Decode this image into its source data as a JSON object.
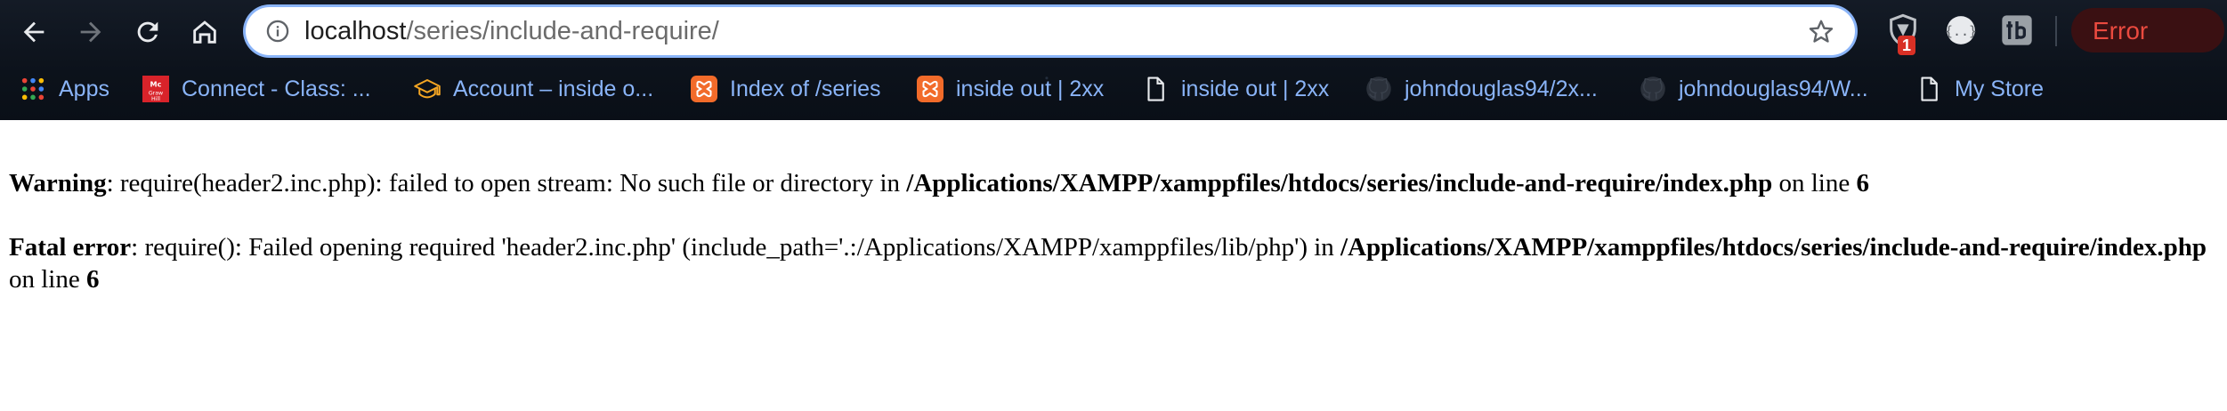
{
  "browser": {
    "address_bar": {
      "url_host": "localhost",
      "url_path": "/series/include-and-require/"
    },
    "extension_badge": "1",
    "profile_button_label": "Error",
    "bookmarks": [
      {
        "label": "Apps",
        "icon": "apps-grid-icon"
      },
      {
        "label": "Connect - Class: ...",
        "icon": "mcgraw-hill-icon"
      },
      {
        "label": "Account – inside o...",
        "icon": "graduation-cap-icon"
      },
      {
        "label": "Index of /series",
        "icon": "xampp-icon"
      },
      {
        "label": "inside out | 2xx",
        "icon": "xampp-icon"
      },
      {
        "label": "inside out | 2xx",
        "icon": "document-icon"
      },
      {
        "label": "johndouglas94/2x...",
        "icon": "github-icon"
      },
      {
        "label": "johndouglas94/W...",
        "icon": "github-icon"
      },
      {
        "label": "My Store",
        "icon": "document-icon"
      }
    ],
    "colors": {
      "bookmark_text": "#8ab4f8",
      "error_text": "#ea4a3f",
      "xampp_orange": "#f26b2a"
    }
  },
  "page": {
    "warning": {
      "label": "Warning",
      "message": ": require(header2.inc.php): failed to open stream: No such file or directory in ",
      "path": "/Applications/XAMPP/xamppfiles/htdocs/series/include-and-require/index.php",
      "on_line": " on line ",
      "line": "6"
    },
    "fatal": {
      "label": "Fatal error",
      "message": ": require(): Failed opening required 'header2.inc.php' (include_path='.:/Applications/XAMPP/xamppfiles/lib/php') in ",
      "path": "/Applications/XAMPP/xamppfiles/htdocs/series/include-and-require/index.php",
      "on_line": " on line ",
      "line": "6"
    }
  }
}
